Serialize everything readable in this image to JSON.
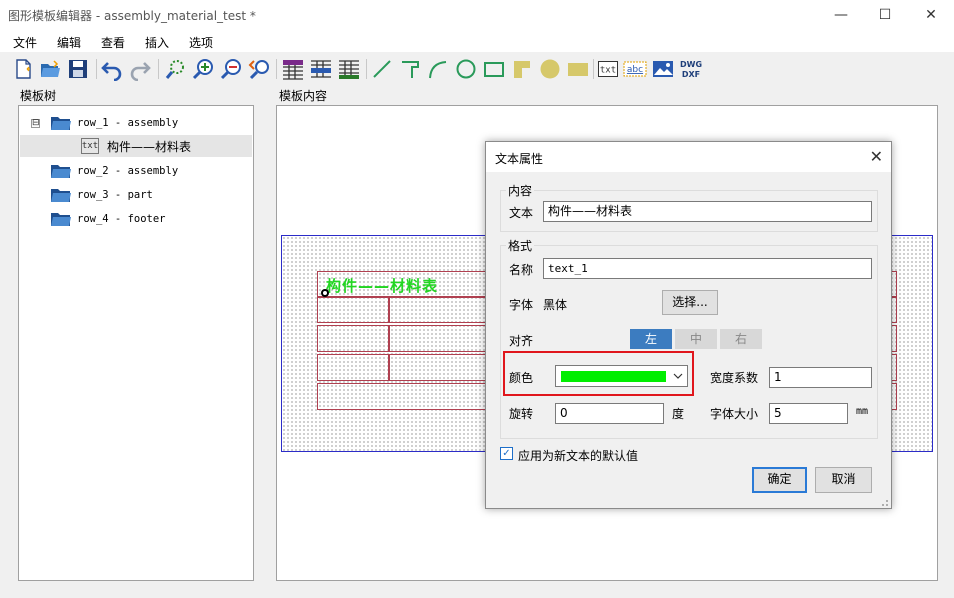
{
  "window": {
    "title": "图形模板编辑器 - assembly_material_test *",
    "minimize": "—",
    "maximize": "☐",
    "close": "✕"
  },
  "menu": [
    "文件",
    "编辑",
    "查看",
    "插入",
    "选项"
  ],
  "toolbar": {
    "icons": [
      "new-file",
      "open-folder",
      "save",
      "undo",
      "redo",
      "zoom-fit",
      "zoom-in",
      "zoom-out",
      "zoom-previous",
      "table-header",
      "table-body",
      "table-grid",
      "line",
      "polyline",
      "arc",
      "circle",
      "rectangle",
      "filled-polygon",
      "filled-circle",
      "filled-rectangle",
      "text",
      "text-field",
      "image",
      "dwg-dxf"
    ],
    "text_label": "txt",
    "text_field_label": "abc",
    "dwg_label": "DWG",
    "dxf_label": "DXF"
  },
  "tree_panel": {
    "label": "模板树",
    "expander": "⊟",
    "items": [
      {
        "label": "row_1 - assembly"
      },
      {
        "label": "构件——材料表",
        "icon_text": "txt"
      },
      {
        "label": "row_2 - assembly"
      },
      {
        "label": "row_3 - part"
      },
      {
        "label": "row_4 - footer"
      }
    ]
  },
  "canvas_panel": {
    "label": "模板内容",
    "text": "构件——材料表"
  },
  "dialog": {
    "title": "文本属性",
    "close": "✕",
    "content_group": "内容",
    "text_label": "文本",
    "text_value": "构件——材料表",
    "format_group": "格式",
    "name_label": "名称",
    "name_value": "text_1",
    "font_label": "字体",
    "font_value": "黑体",
    "choose_button": "选择...",
    "align_label": "对齐",
    "align_left": "左",
    "align_center": "中",
    "align_right": "右",
    "align_selected": "左",
    "color_label": "颜色",
    "color_value": "#00ee00",
    "width_factor_label": "宽度系数",
    "width_factor_value": "1",
    "rotation_label": "旋转",
    "rotation_value": "0",
    "rotation_unit": "度",
    "font_size_label": "字体大小",
    "font_size_value": "5",
    "font_size_unit": "mm",
    "default_checkbox_label": "应用为新文本的默认值",
    "default_checked": true,
    "ok_button": "确定",
    "cancel_button": "取消"
  },
  "colors": {
    "accent": "#2a7ad6",
    "highlight": "#e0161c",
    "text_color": "#22d622",
    "paper_border": "#2c2cc8",
    "cell_border": "#b04050"
  }
}
